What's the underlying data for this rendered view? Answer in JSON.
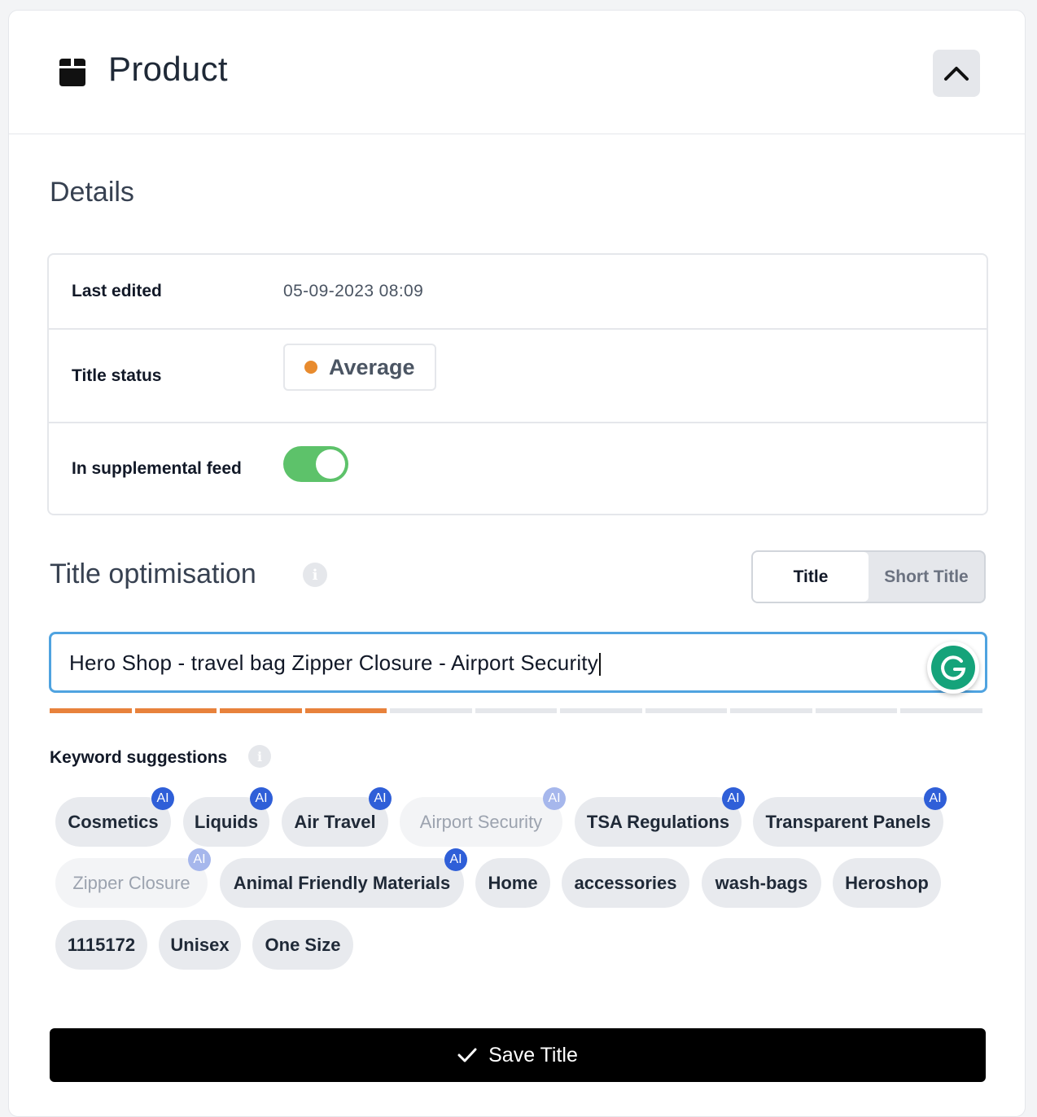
{
  "header": {
    "title": "Product",
    "icon": "box-icon",
    "collapse_icon": "chevron-up-icon"
  },
  "details": {
    "heading": "Details",
    "last_edited": {
      "label": "Last edited",
      "value": "05-09-2023 08:09"
    },
    "title_status": {
      "label": "Title status",
      "value": "Average",
      "dot_color": "#e88b2e"
    },
    "supplemental": {
      "label": "In supplemental feed",
      "enabled": true,
      "color": "#5dc26a"
    }
  },
  "optimisation": {
    "heading": "Title optimisation",
    "tabs": [
      {
        "label": "Title",
        "active": true
      },
      {
        "label": "Short Title",
        "active": false
      }
    ],
    "input_value": "Hero Shop - travel bag Zipper Closure - Airport Security",
    "progress": {
      "filled": 4,
      "total": 11,
      "color": "#e8823c"
    }
  },
  "keywords": {
    "label": "Keyword suggestions",
    "ai_badge": "AI",
    "rows": [
      [
        {
          "label": "Cosmetics",
          "ai": true,
          "muted": false
        },
        {
          "label": "Liquids",
          "ai": true,
          "muted": false
        },
        {
          "label": "Air Travel",
          "ai": true,
          "muted": false
        },
        {
          "label": "Airport Security",
          "ai": true,
          "muted": true
        },
        {
          "label": "TSA Regulations",
          "ai": true,
          "muted": false
        },
        {
          "label": "Transparent Panels",
          "ai": true,
          "muted": false
        }
      ],
      [
        {
          "label": "Zipper Closure",
          "ai": true,
          "muted": true
        },
        {
          "label": "Animal Friendly Materials",
          "ai": true,
          "muted": false
        },
        {
          "label": "Home",
          "ai": false,
          "muted": false
        },
        {
          "label": "accessories",
          "ai": false,
          "muted": false
        },
        {
          "label": "wash-bags",
          "ai": false,
          "muted": false
        },
        {
          "label": "Heroshop",
          "ai": false,
          "muted": false
        }
      ],
      [
        {
          "label": "1115172",
          "ai": false,
          "muted": false
        },
        {
          "label": "Unisex",
          "ai": false,
          "muted": false
        },
        {
          "label": "One Size",
          "ai": false,
          "muted": false
        }
      ]
    ]
  },
  "save_button": {
    "label": "Save Title",
    "icon": "check-icon"
  }
}
